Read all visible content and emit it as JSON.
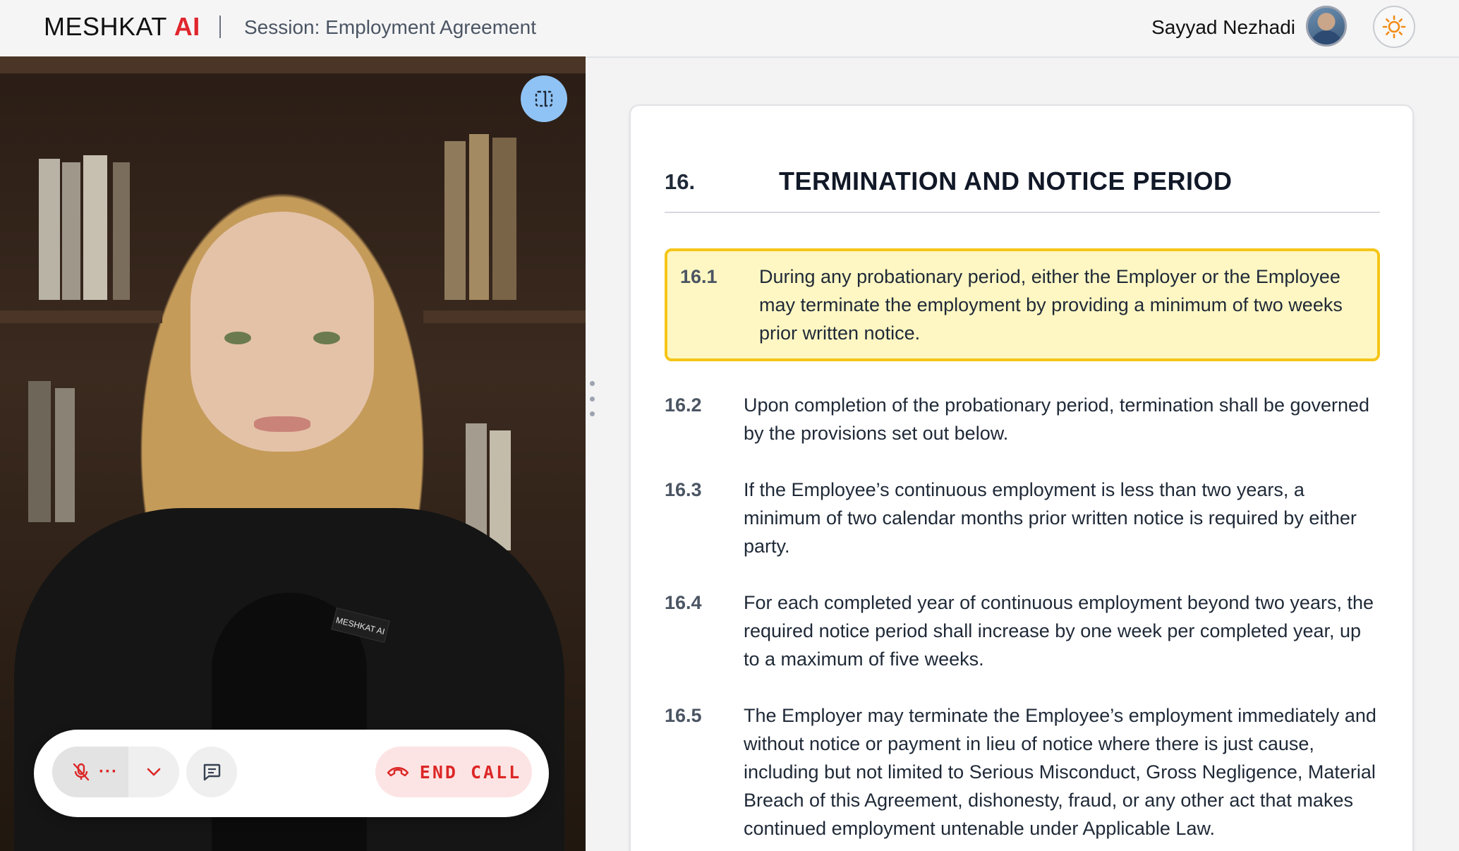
{
  "header": {
    "brand_main": "MESHKAT",
    "brand_accent": "AI",
    "session_label": "Session: Employment Agreement",
    "user_name": "Sayyad Nezhadi",
    "theme_icon": "sun-icon"
  },
  "video": {
    "badge_text": "MESHKAT AI",
    "controls": {
      "mic_state": "muted",
      "end_call_label": "END CALL"
    }
  },
  "document": {
    "section_number": "16.",
    "section_title": "TERMINATION AND NOTICE PERIOD",
    "clauses": [
      {
        "num": "16.1",
        "text": "During any probationary period, either the Employer or the Employee may terminate the employment by providing a minimum of two weeks prior written notice.",
        "highlighted": true
      },
      {
        "num": "16.2",
        "text": "Upon completion of the probationary period, termination shall be governed by the provisions set out below."
      },
      {
        "num": "16.3",
        "text": "If the Employee’s continuous employment is less than two years, a minimum of two calendar months prior written notice is required by either party."
      },
      {
        "num": "16.4",
        "text": "For each completed year of continuous employment beyond two years, the required notice period shall increase by one week per completed year, up to a maximum of five weeks."
      },
      {
        "num": "16.5",
        "text": "The Employer may terminate the Employee’s employment immediately and without notice or payment in lieu of notice where there is just cause, including but not limited to Serious Misconduct, Gross Negligence, Material Breach of this Agreement, dishonesty, fraud, or any other act that makes continued employment untenable under Applicable Law."
      }
    ]
  },
  "colors": {
    "brand_accent": "#e0262d",
    "highlight_bg": "#fef7c3",
    "highlight_border": "#f5c518",
    "end_call": "#dc2626",
    "expand_button": "#90c3f5"
  }
}
